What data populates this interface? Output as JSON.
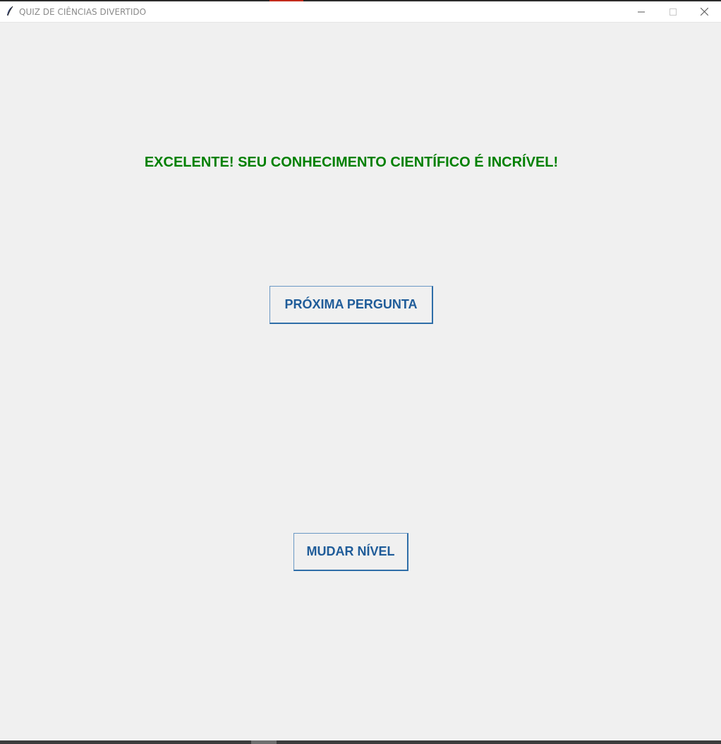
{
  "window": {
    "title": "QUIZ DE CIÊNCIAS DIVERTIDO",
    "icon": "feather-icon",
    "controls": {
      "minimize_icon": "minimize-icon",
      "maximize_icon": "maximize-icon",
      "close_icon": "close-icon"
    }
  },
  "main": {
    "feedback_text": "EXCELENTE! SEU CONHECIMENTO CIENTÍFICO É INCRÍVEL!",
    "next_question_label": "PRÓXIMA PERGUNTA",
    "change_level_label": "MUDAR NÍVEL"
  },
  "colors": {
    "background": "#f0f0f0",
    "feedback": "#008000",
    "button_text": "#1f5c99",
    "button_border": "#2f6ea8"
  }
}
